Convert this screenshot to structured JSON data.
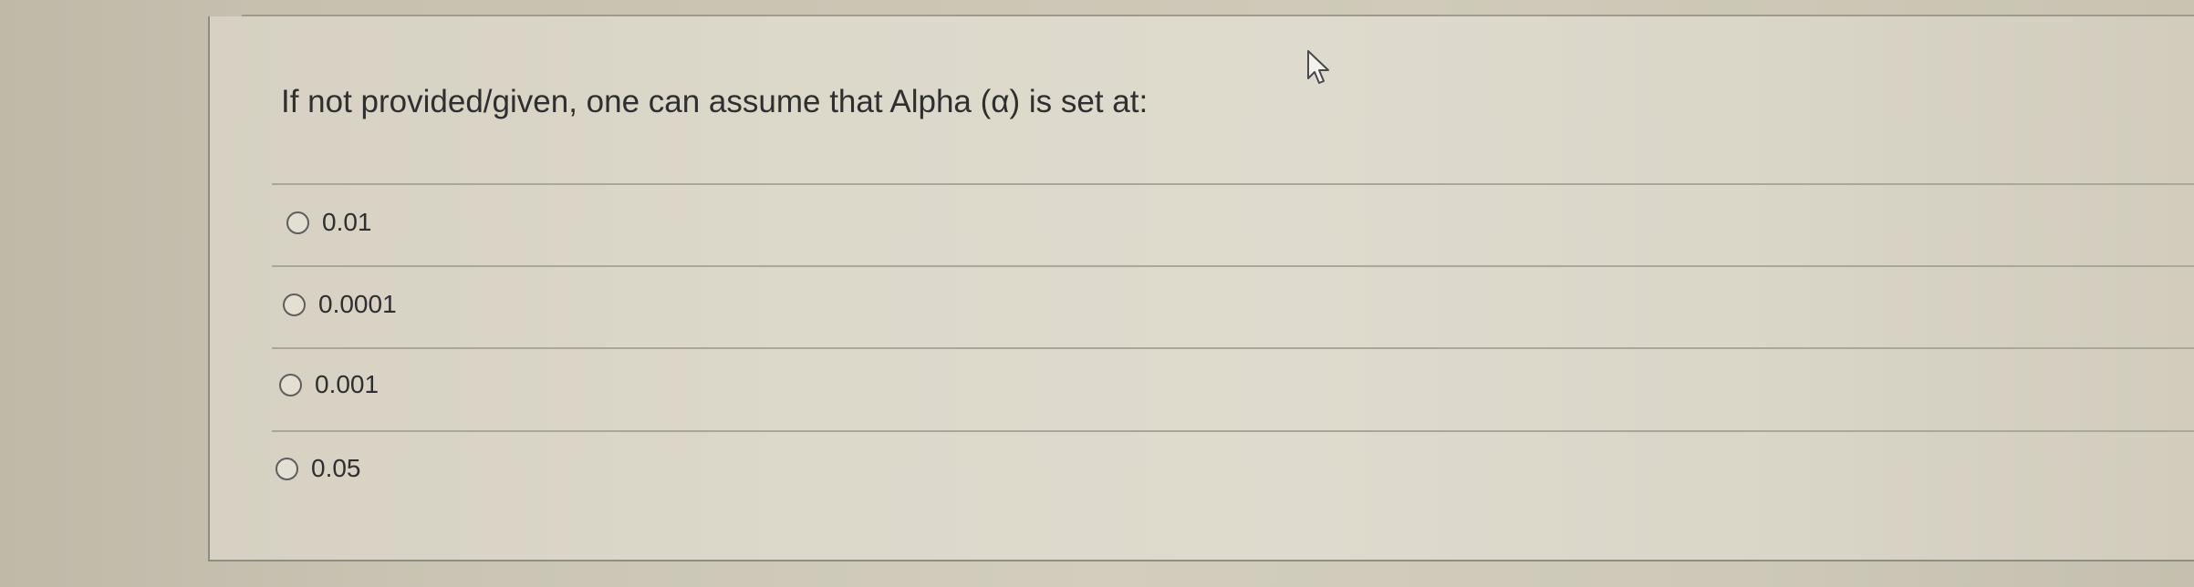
{
  "question": {
    "text": "If not provided/given, one can assume that Alpha (α) is set at:"
  },
  "options": [
    {
      "label": "0.01",
      "selected": false
    },
    {
      "label": "0.0001",
      "selected": false
    },
    {
      "label": "0.001",
      "selected": false
    },
    {
      "label": "0.05",
      "selected": false
    }
  ],
  "cursor": {
    "icon": "arrow-cursor-icon"
  }
}
